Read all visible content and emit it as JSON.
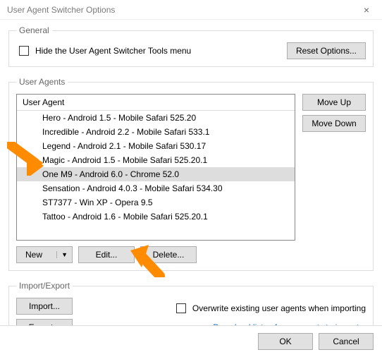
{
  "window": {
    "title": "User Agent Switcher Options",
    "close": "×"
  },
  "general": {
    "legend": "General",
    "hide_label": "Hide the User Agent Switcher Tools menu",
    "hide_checked": false,
    "reset_label": "Reset Options..."
  },
  "user_agents": {
    "legend": "User Agents",
    "header": "User Agent",
    "items": [
      "Hero - Android 1.5 - Mobile Safari 525.20",
      "Incredible - Android 2.2 - Mobile Safari 533.1",
      "Legend - Android 2.1 - Mobile Safari 530.17",
      "Magic - Android 1.5 - Mobile Safari 525.20.1",
      "One M9 - Android 6.0 - Chrome 52.0",
      "Sensation - Android 4.0.3 - Mobile Safari 534.30",
      "ST7377 - Win XP - Opera 9.5",
      "Tattoo - Android 1.6 - Mobile Safari 525.20.1"
    ],
    "selected_index": 4,
    "move_up": "Move Up",
    "move_down": "Move Down",
    "new": "New",
    "edit": "Edit...",
    "delete": "Delete..."
  },
  "import_export": {
    "legend": "Import/Export",
    "import": "Import...",
    "export": "Export...",
    "overwrite_label": "Overwrite existing user agents when importing",
    "overwrite_checked": false,
    "download_link": "Download lists of user agents to import..."
  },
  "footer": {
    "ok": "OK",
    "cancel": "Cancel"
  }
}
